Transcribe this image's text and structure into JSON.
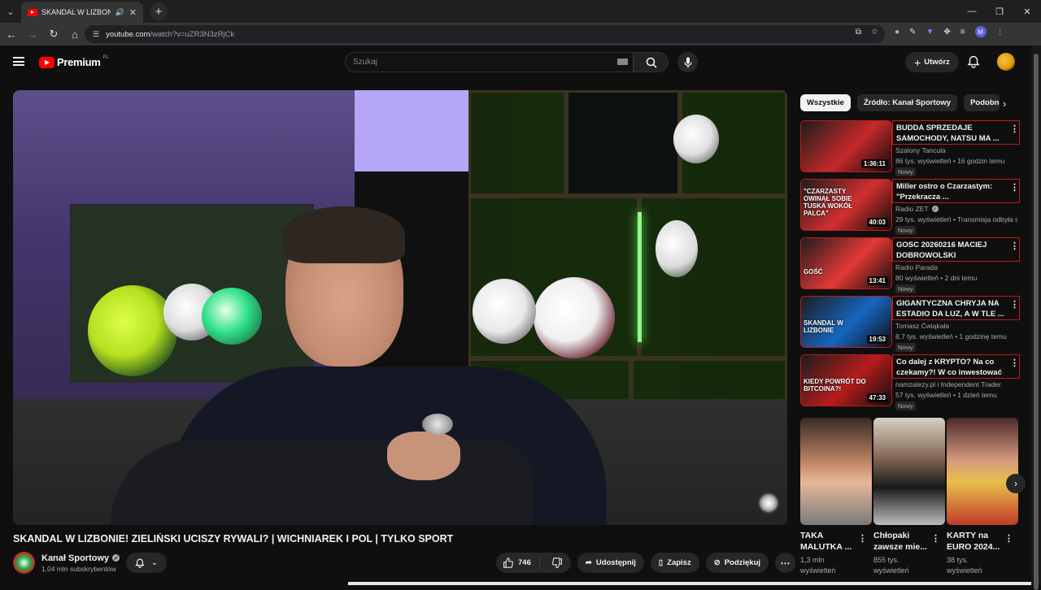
{
  "browser": {
    "tab_title": "SKANDAL W LIZBONIE! ZIEL",
    "url_host": "youtube.com",
    "url_path": "/watch?v=uZR3N3zRjCk",
    "profile_initial": "M"
  },
  "header": {
    "brand": "Premium",
    "region": "PL",
    "search_placeholder": "Szukaj",
    "create_label": "Utwórz"
  },
  "video": {
    "title": "SKANDAL W LIZBONIE! ZIELIŃSKI UCISZY RYWALI? | WICHNIAREK I POL | TYLKO SPORT",
    "channel": "Kanał Sportowy",
    "subscribers": "1,04 mln subskrybentów",
    "likes": "746",
    "share_label": "Udostępnij",
    "save_label": "Zapisz",
    "thanks_label": "Podziękuj"
  },
  "chips": [
    "Wszystkie",
    "Źródło: Kanał Sportowy",
    "Podobne"
  ],
  "recommendations": [
    {
      "title": "BUDDA SPRZEDAJE SAMOCHODY, NATSU MA ...",
      "channel": "Szalony Tancula",
      "meta": "86 tys. wyświetleń • 16 godzin temu",
      "badge": "Nowy",
      "duration": "1:36:11",
      "verified": false,
      "thumb_text": "",
      "accent": "#c62828"
    },
    {
      "title": "Miller ostro o Czarzastym: \"Przekracza ...",
      "channel": "Radio ZET",
      "meta": "29 tys. wyświetleń • Transmisja odbyła s...",
      "badge": "Nowy",
      "duration": "40:03",
      "verified": true,
      "thumb_text": "\"CZARZASTY OWINĄŁ SOBIE TUSKA WOKÓŁ PALCA\"",
      "accent": "#d32f2f"
    },
    {
      "title": "GOSC 20260216 MACIEJ DOBROWOLSKI",
      "channel": "Radio Parada",
      "meta": "80 wyświetleń • 2 dni temu",
      "badge": "Nowy",
      "duration": "13:41",
      "verified": false,
      "thumb_text": "GOŚĆ",
      "accent": "#e53935"
    },
    {
      "title": "GIGANTYCZNA CHRYJA NA ESTADIO DA LUZ, A W TLE ...",
      "channel": "Tomasz Ćwiąkała",
      "meta": "8,7 tys. wyświetleń • 1 godzinę temu",
      "badge": "Nowy",
      "duration": "19:53",
      "verified": false,
      "thumb_text": "SKANDAL W LIZBONIE",
      "accent": "#1565c0"
    },
    {
      "title": "Co dalej z KRYPTO? Na co czekamy?! W co inwestować ...",
      "channel": "namzalezy.pl i Independent Trader",
      "meta": "57 tys. wyświetleń • 1 dzień temu",
      "badge": "Nowy",
      "duration": "47:33",
      "verified": false,
      "thumb_text": "KIEDY POWRÓT DO BITCOINA?!",
      "accent": "#b71c1c"
    }
  ],
  "shorts": [
    {
      "title": "TAKA MALUTKA ...",
      "views": "1,3 mln wyświetleń"
    },
    {
      "title": "Chłopaki zawsze mie...",
      "views": "855 tys. wyświetleń"
    },
    {
      "title": "KARTY na EURO 2024...",
      "views": "38 tys. wyświetleń"
    }
  ]
}
